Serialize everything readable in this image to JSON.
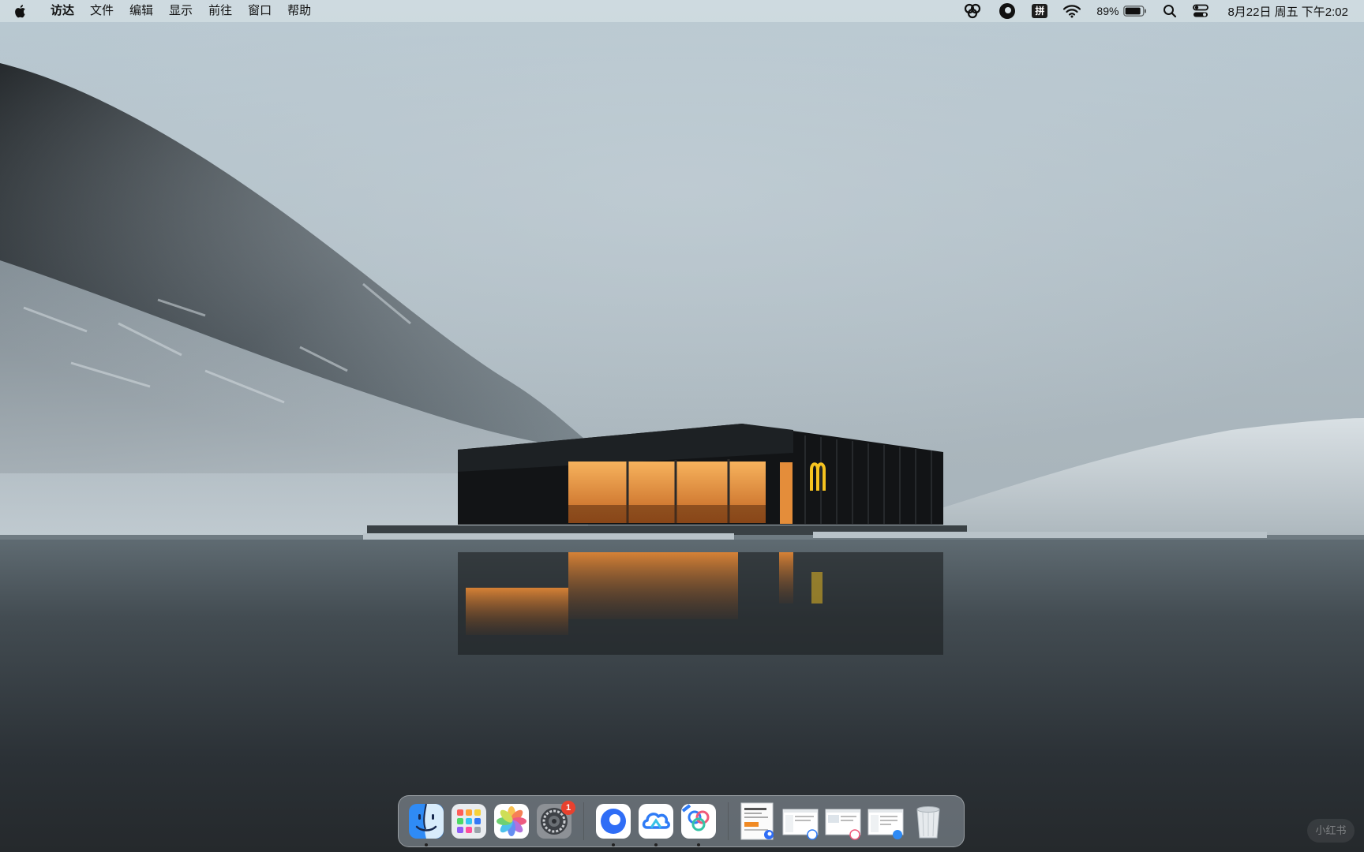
{
  "menubar": {
    "apple_icon": "apple-logo-icon",
    "app_name": "访达",
    "menus": [
      "文件",
      "编辑",
      "显示",
      "前往",
      "窗口",
      "帮助"
    ],
    "status": {
      "input_method": "拼",
      "battery_percent": "89%",
      "battery_level": 0.89,
      "clock": "8月22日 周五 下午2:02"
    }
  },
  "dock": {
    "apps": [
      {
        "name": "Finder",
        "icon": "finder-icon",
        "running": true
      },
      {
        "name": "Launchpad",
        "icon": "launchpad-icon",
        "running": false
      },
      {
        "name": "Photos",
        "icon": "photos-icon",
        "running": false
      },
      {
        "name": "System Settings",
        "icon": "settings-icon",
        "running": false,
        "badge": "1"
      },
      {
        "name": "Browser",
        "icon": "browser-icon",
        "running": true
      },
      {
        "name": "Cloud Drive",
        "icon": "cloud-drive-icon",
        "running": true
      },
      {
        "name": "Cloud Photos",
        "icon": "cloud-photos-icon",
        "running": true
      }
    ],
    "minimized_windows": [
      "window-thumbnail-1",
      "window-thumbnail-2",
      "window-thumbnail-3",
      "window-thumbnail-4"
    ],
    "trash_icon": "trash-icon"
  },
  "watermark": "小红书",
  "colors": {
    "menubar_bg": "#d6e0e5",
    "sky": "#b6c4cc",
    "water": "#2a3035",
    "building_glow": "#f39a3a",
    "logo_yellow": "#f5c320",
    "badge_red": "#e8412e"
  }
}
